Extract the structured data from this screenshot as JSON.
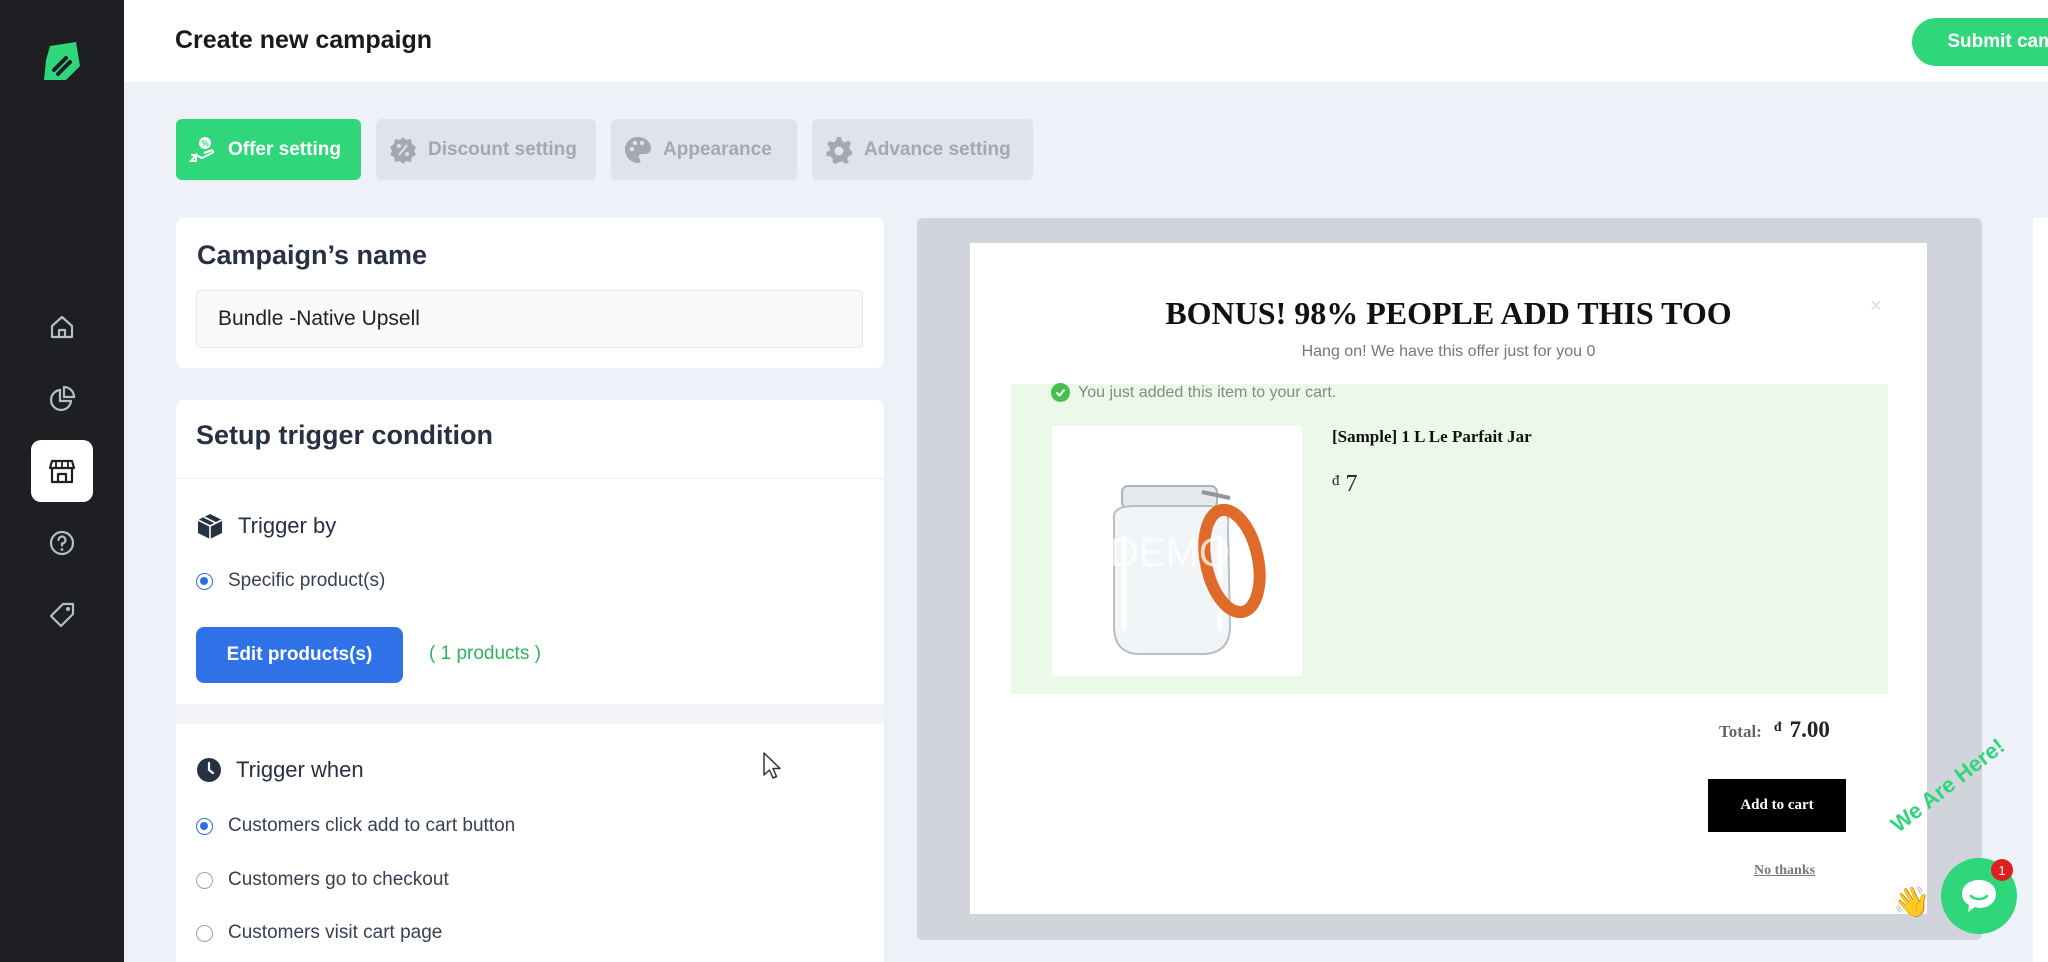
{
  "header": {
    "title": "Create new campaign",
    "submit_label": "Submit campaign"
  },
  "sidebar": {
    "items": [
      {
        "icon": "home-icon"
      },
      {
        "icon": "analytics-icon"
      },
      {
        "icon": "store-icon",
        "active": true
      },
      {
        "icon": "help-icon"
      },
      {
        "icon": "tag-icon"
      }
    ]
  },
  "tabs": [
    {
      "label": "Offer setting",
      "active": true,
      "icon": "offer-icon"
    },
    {
      "label": "Discount setting",
      "icon": "discount-icon"
    },
    {
      "label": "Appearance",
      "icon": "palette-icon"
    },
    {
      "label": "Advance setting",
      "icon": "gear-icon"
    }
  ],
  "campaign_name": {
    "title": "Campaign’s name",
    "value": "Bundle -Native Upsell"
  },
  "trigger": {
    "title": "Setup trigger condition",
    "trigger_by": {
      "label": "Trigger by",
      "option": "Specific product(s)",
      "edit_label": "Edit products(s)",
      "count": "( 1 products )"
    },
    "trigger_when": {
      "label": "Trigger when",
      "options": [
        {
          "label": "Customers click add to cart button",
          "selected": true
        },
        {
          "label": "Customers go to checkout",
          "selected": false
        },
        {
          "label": "Customers visit cart page",
          "selected": false
        }
      ]
    }
  },
  "preview": {
    "title": "BONUS! 98% PEOPLE ADD THIS TOO",
    "subtitle": "Hang on! We have this offer just for you 0",
    "close": "×",
    "added_note": "You just added this item to your cart.",
    "product_name": "[Sample] 1 L Le Parfait Jar",
    "currency": "đ",
    "product_price": "7",
    "watermark": "DEMO",
    "total_label": "Total:",
    "total_value": "7.00",
    "add_to_cart": "Add to cart",
    "no_thanks": "No thanks"
  },
  "chat": {
    "badge": "1",
    "tagline": "We Are Here!"
  },
  "colors": {
    "accent": "#2fd77a",
    "primary_button": "#2f72e8",
    "sidebar_bg": "#1d1f22"
  }
}
